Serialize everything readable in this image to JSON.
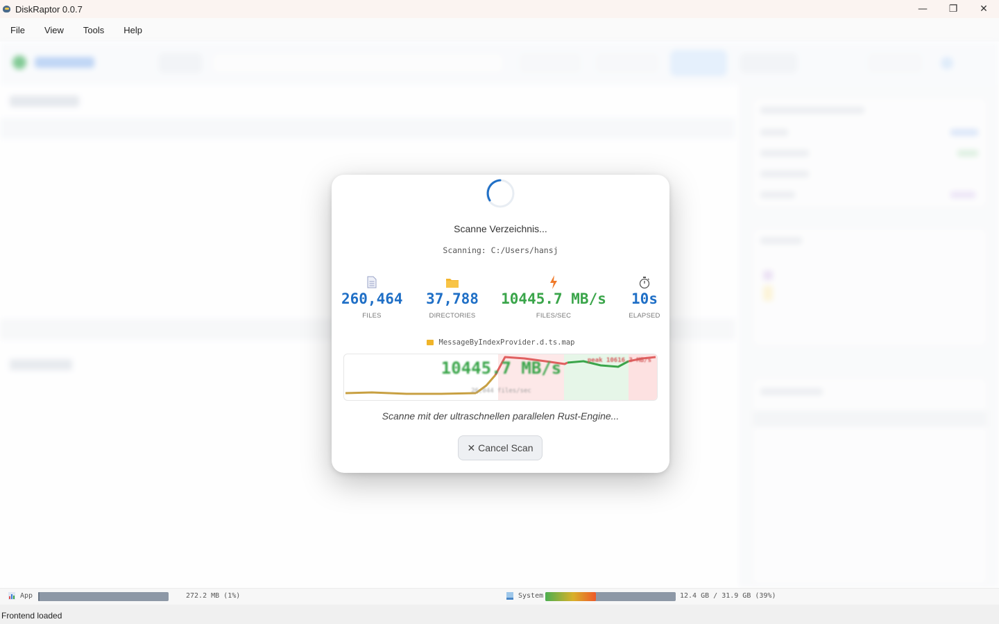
{
  "window": {
    "title": "DiskRaptor 0.0.7",
    "controls": [
      "—",
      "❐",
      "✕"
    ]
  },
  "menu": [
    "File",
    "View",
    "Tools",
    "Help"
  ],
  "scan_modal": {
    "title": "Scanne Verzeichnis...",
    "path_label": "Scanning: C:/Users/hansj",
    "stats": [
      {
        "icon": "file-icon",
        "value": "260,464",
        "label": "FILES",
        "color": "#1f6fc6"
      },
      {
        "icon": "folder-icon",
        "value": "37,788",
        "label": "DIRECTORIES",
        "color": "#1f6fc6"
      },
      {
        "icon": "lightning-icon",
        "value": "10445.7 MB/s",
        "label": "FILES/SEC",
        "color": "#3aa54a"
      },
      {
        "icon": "stopwatch-icon",
        "value": "10s",
        "label": "ELAPSED",
        "color": "#1f6fc6"
      }
    ],
    "current_file": "MessageByIndexProvider.d.ts.map",
    "throughput": {
      "big": "10445.7 MB/s",
      "peak": "peak 10616.3 MB/s",
      "rate": "26,044 files/sec"
    },
    "subtitle": "Scanne mit der ultraschnellen parallelen Rust-Engine...",
    "cancel_label": "✕ Cancel Scan"
  },
  "meters": {
    "app_label": "App",
    "app_value": "272.2 MB (1%)",
    "app_fraction": 0.01,
    "system_label": "System",
    "system_value": "12.4 GB / 31.9 GB (39%)",
    "system_fraction": 0.39
  },
  "status": "Frontend loaded"
}
